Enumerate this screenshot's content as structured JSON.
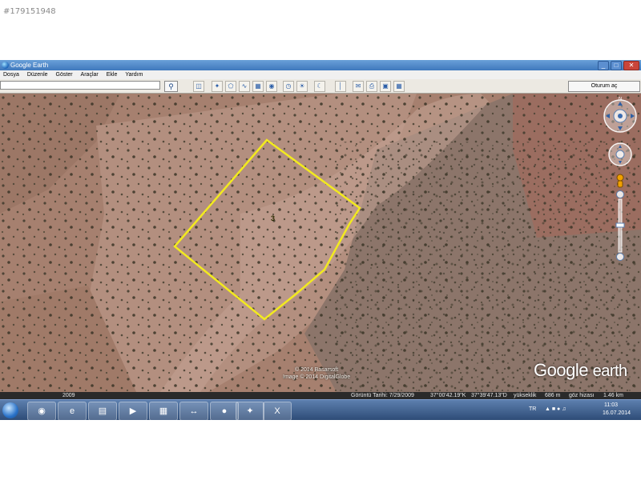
{
  "listing_id": "#179151948",
  "window": {
    "title": "Google Earth",
    "minimize": "_",
    "maximize": "□",
    "close": "✕"
  },
  "menu": [
    {
      "label": "Dosya"
    },
    {
      "label": "Düzenle"
    },
    {
      "label": "Göster"
    },
    {
      "label": "Araçlar"
    },
    {
      "label": "Ekle"
    },
    {
      "label": "Yardım"
    }
  ],
  "toolbar": {
    "search_value": "",
    "search_icon": "magnifier-icon",
    "sign_in_label": "Oturum aç",
    "tools": [
      "sidebar-icon",
      "placemark-icon",
      "polygon-icon",
      "path-icon",
      "overlay-icon",
      "tour-icon",
      "historical-imagery-icon",
      "sun-icon",
      "planets-icon",
      "ruler-icon",
      "email-icon",
      "print-icon",
      "save-image-icon",
      "maps-icon"
    ]
  },
  "map": {
    "parcel_label": "3",
    "copyright_line1": "© 2014 Basarsoft",
    "copyright_line2": "Image © 2014 DigitalGlobe",
    "logo_word1": "Google",
    "logo_word2": "earth",
    "year_badge": "2009",
    "parcel_color": "#f2ea1f"
  },
  "navigation": {
    "north_label": "N"
  },
  "status": {
    "imagery_date": "Görüntü Tarihi: 7/29/2009",
    "latitude": "37°00'42.19\"K",
    "longitude": "37°39'47.13\"D",
    "elevation_label": "yükseklik",
    "elevation_value": "686 m",
    "eye_alt_label": "göz hizası",
    "eye_alt_value": "1.46 km"
  },
  "taskbar": {
    "apps": [
      "chrome-icon",
      "ie-icon",
      "folder-icon",
      "media-player-icon",
      "calculator-icon",
      "teamviewer-icon",
      "google-earth-icon",
      "maps-app-icon",
      "excel-icon"
    ],
    "language": "TR",
    "time": "11:03",
    "date": "16.07.2014"
  }
}
